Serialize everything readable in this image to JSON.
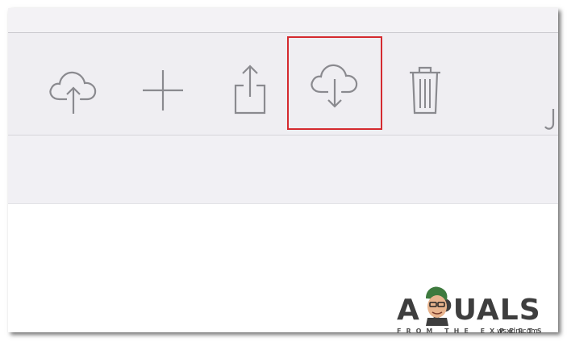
{
  "toolbar": {
    "buttons": [
      {
        "name": "upload",
        "icon": "cloud-upload-icon"
      },
      {
        "name": "add",
        "icon": "plus-icon"
      },
      {
        "name": "share",
        "icon": "share-icon"
      },
      {
        "name": "download",
        "icon": "cloud-download-icon",
        "highlighted": true
      },
      {
        "name": "delete",
        "icon": "trash-icon"
      }
    ],
    "icon_color": "#8a8a8f",
    "highlight_color": "#d42a2f"
  },
  "watermark": {
    "brand_text": "A  PUALS",
    "tagline": "FROM THE EXPERTS",
    "site": "wsxdn.com"
  }
}
